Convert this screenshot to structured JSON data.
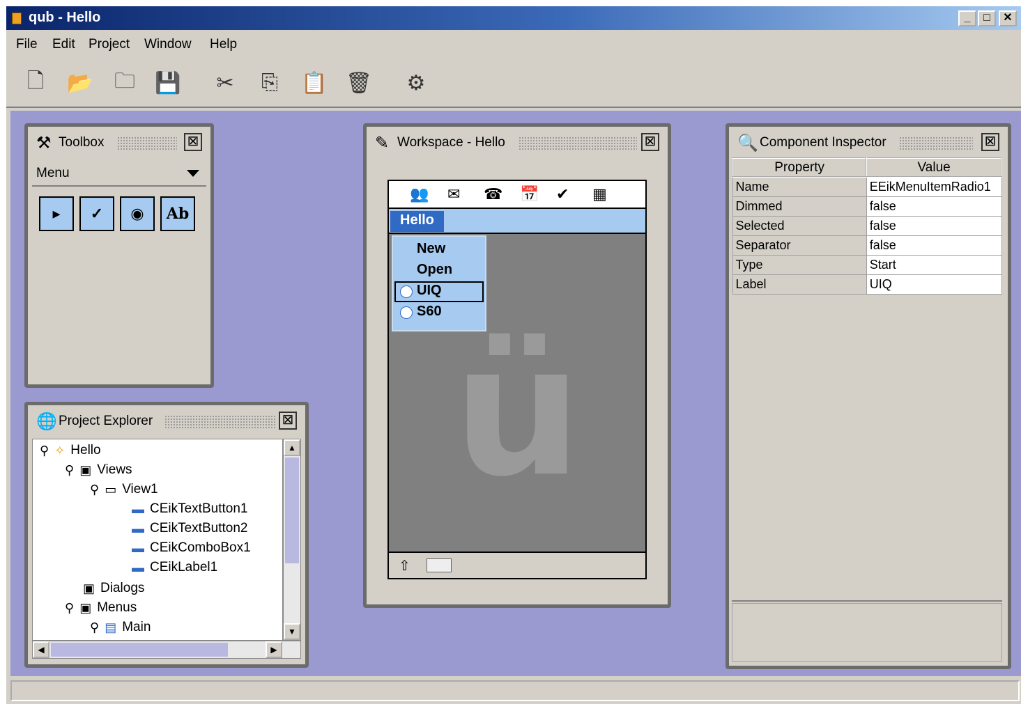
{
  "window": {
    "title": "qub - Hello",
    "min": "_",
    "max": "□",
    "close": "✕"
  },
  "menubar": [
    "File",
    "Edit",
    "Project",
    "Window",
    "Help"
  ],
  "toolbar": [
    {
      "name": "new-file-icon",
      "glyph": "🗋"
    },
    {
      "name": "open-folder-icon",
      "glyph": "📂"
    },
    {
      "name": "open-project-icon",
      "glyph": "🗀"
    },
    {
      "name": "save-icon",
      "glyph": "💾"
    },
    {
      "name": "cut-icon",
      "glyph": "✂"
    },
    {
      "name": "copy-icon",
      "glyph": "⎘"
    },
    {
      "name": "paste-icon",
      "glyph": "📋"
    },
    {
      "name": "delete-icon",
      "glyph": "🗑"
    },
    {
      "name": "settings-gear-icon",
      "glyph": "⚙"
    }
  ],
  "toolbox": {
    "title": "Toolbox",
    "category": "Menu",
    "tools": [
      {
        "name": "menu-cascade-tool",
        "glyph": "▸"
      },
      {
        "name": "menu-checkbox-tool",
        "glyph": "✓"
      },
      {
        "name": "menu-radio-tool",
        "glyph": "◉"
      },
      {
        "name": "menu-text-tool",
        "glyph": "Ab"
      }
    ]
  },
  "workspace": {
    "title": "Workspace - Hello",
    "menu_title": "Hello",
    "menu_items": [
      "New",
      "Open",
      "UIQ",
      "S60"
    ],
    "bottom_arrow": "⇧",
    "logo": "ü"
  },
  "project_explorer": {
    "title": "Project Explorer",
    "tree": [
      {
        "label": "Hello",
        "depth": 0,
        "icon": "✧"
      },
      {
        "label": "Views",
        "depth": 1,
        "icon": "▣"
      },
      {
        "label": "View1",
        "depth": 2,
        "icon": "▭"
      },
      {
        "label": "CEikTextButton1",
        "depth": 3,
        "icon": "▬"
      },
      {
        "label": "CEikTextButton2",
        "depth": 3,
        "icon": "▬"
      },
      {
        "label": "CEikComboBox1",
        "depth": 3,
        "icon": "▬"
      },
      {
        "label": "CEikLabel1",
        "depth": 3,
        "icon": "▬"
      },
      {
        "label": "Dialogs",
        "depth": 1,
        "icon": "▣"
      },
      {
        "label": "Menus",
        "depth": 1,
        "icon": "▣"
      },
      {
        "label": "Main",
        "depth": 2,
        "icon": "▤"
      }
    ]
  },
  "inspector": {
    "title": "Component Inspector",
    "col_property": "Property",
    "col_value": "Value",
    "rows": [
      {
        "property": "Name",
        "value": "EEikMenuItemRadio1"
      },
      {
        "property": "Dimmed",
        "value": "false"
      },
      {
        "property": "Selected",
        "value": "false"
      },
      {
        "property": "Separator",
        "value": "false"
      },
      {
        "property": "Type",
        "value": "Start"
      },
      {
        "property": "Label",
        "value": "UIQ"
      }
    ]
  }
}
